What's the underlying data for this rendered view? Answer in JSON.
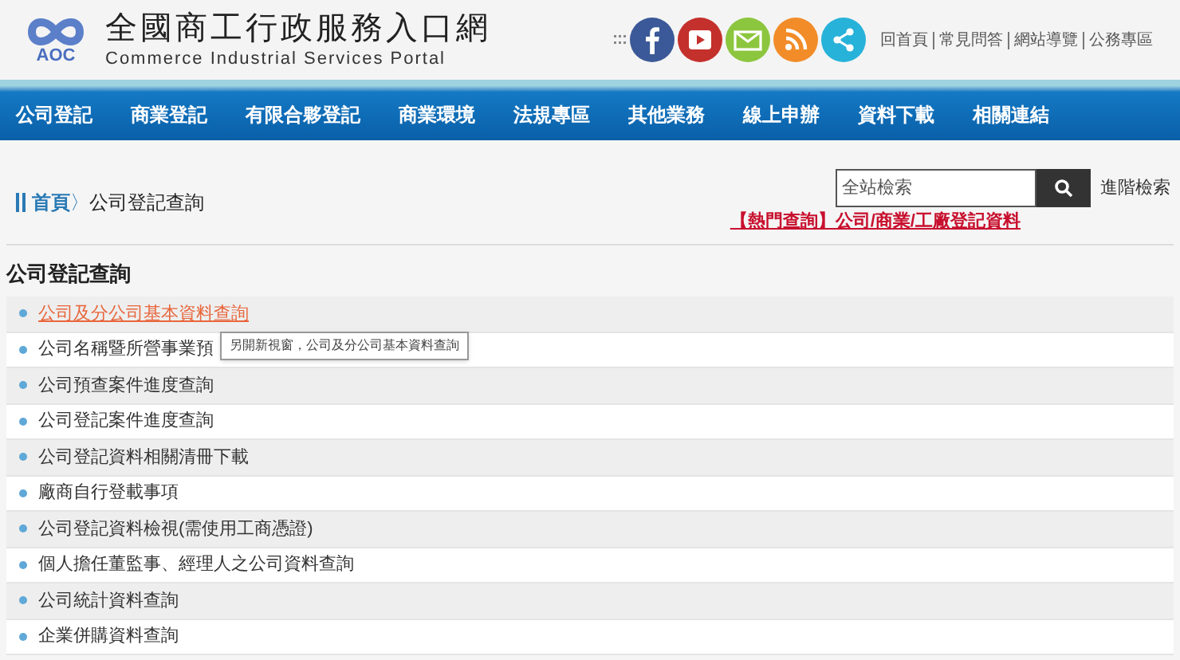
{
  "header": {
    "logo_text": "AOC",
    "title": "全國商工行政服務入口網",
    "subtitle": "Commerce Industrial Services Portal",
    "top_links": [
      "回首頁",
      "常見問答",
      "網站導覽",
      "公務專區"
    ]
  },
  "nav": [
    "公司登記",
    "商業登記",
    "有限合夥登記",
    "商業環境",
    "法規專區",
    "其他業務",
    "線上申辦",
    "資料下載",
    "相關連結"
  ],
  "breadcrumb": {
    "home": "首頁",
    "separator": "〉",
    "current": "公司登記查詢"
  },
  "search": {
    "placeholder": "全站檢索",
    "advanced": "進階檢索"
  },
  "hot_link": "【熱門查詢】公司/商業/工廠登記資料",
  "section_title": "公司登記查詢",
  "items": [
    {
      "label": "公司及分公司基本資料查詢",
      "hovered": true
    },
    {
      "label": "公司名稱暨所營事業預",
      "hovered": false
    },
    {
      "label": "公司預查案件進度查詢",
      "hovered": false
    },
    {
      "label": "公司登記案件進度查詢",
      "hovered": false
    },
    {
      "label": "公司登記資料相關清冊下載",
      "hovered": false
    },
    {
      "label": "廠商自行登載事項",
      "hovered": false
    },
    {
      "label": "公司登記資料檢視(需使用工商憑證)",
      "hovered": false
    },
    {
      "label": "個人擔任董監事、經理人之公司資料查詢",
      "hovered": false
    },
    {
      "label": "公司統計資料查詢",
      "hovered": false
    },
    {
      "label": "企業併購資料查詢",
      "hovered": false
    }
  ],
  "tooltip": "另開新視窗，公司及分公司基本資料查詢"
}
